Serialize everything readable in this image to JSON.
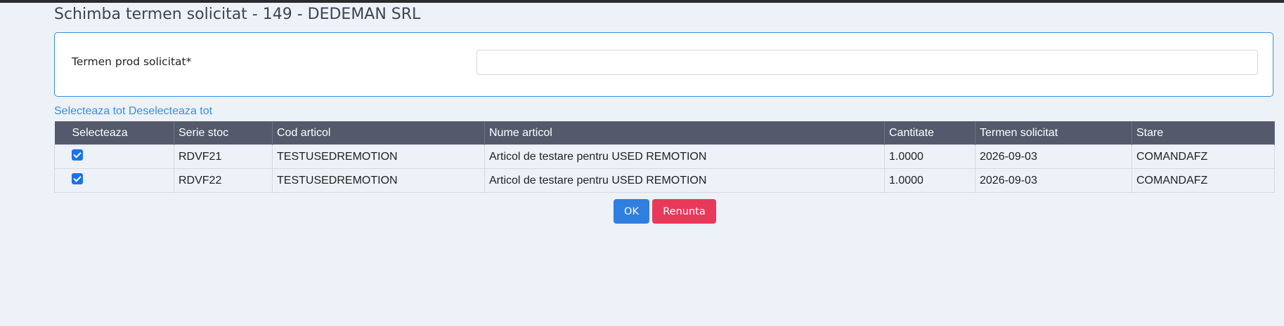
{
  "page": {
    "title": "Schimba termen solicitat - 149 - DEDEMAN SRL"
  },
  "form": {
    "label": "Termen prod solicitat*",
    "value": "",
    "placeholder": ""
  },
  "selection": {
    "select_all": "Selecteaza tot",
    "deselect_all": "Deselecteaza tot"
  },
  "table": {
    "headers": [
      "Selecteaza",
      "Serie stoc",
      "Cod articol",
      "Nume articol",
      "Cantitate",
      "Termen solicitat",
      "Stare"
    ],
    "rows": [
      {
        "checked": true,
        "serie": "RDVF21",
        "cod": "TESTUSEDREMOTION",
        "nume": "Articol de testare pentru USED REMOTION",
        "cantitate": "1.0000",
        "termen": "2026-09-03",
        "stare": "COMANDAFZ"
      },
      {
        "checked": true,
        "serie": "RDVF22",
        "cod": "TESTUSEDREMOTION",
        "nume": "Articol de testare pentru USED REMOTION",
        "cantitate": "1.0000",
        "termen": "2026-09-03",
        "stare": "COMANDAFZ"
      }
    ]
  },
  "buttons": {
    "ok": "OK",
    "cancel": "Renunta"
  },
  "colors": {
    "accent": "#3a8ee0",
    "header_bg": "#545a6b",
    "ok_button": "#2f7fe0",
    "cancel_button": "#e8395a",
    "page_bg": "#edf1f8"
  }
}
